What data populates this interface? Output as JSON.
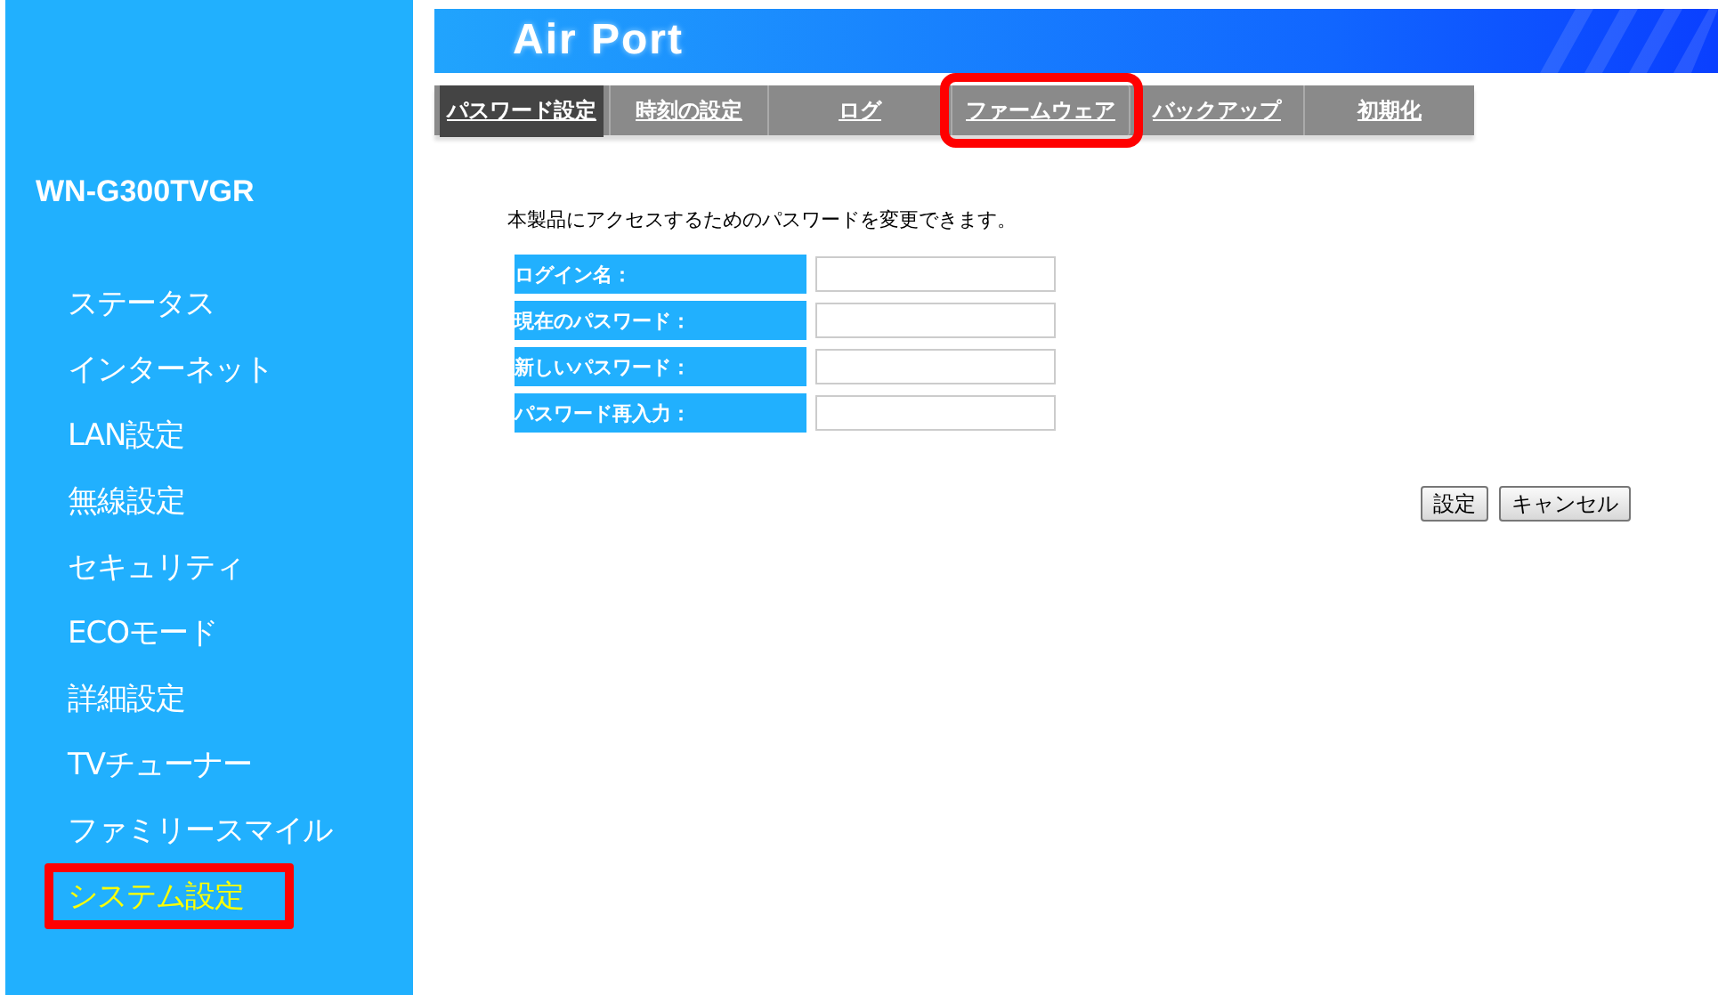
{
  "header": {
    "logo": "Air Port"
  },
  "sidebar": {
    "model": "WN-G300TVGR",
    "items": [
      {
        "label": "ステータス",
        "selected": false,
        "highlighted": false
      },
      {
        "label": "インターネット",
        "selected": false,
        "highlighted": false
      },
      {
        "label": "LAN設定",
        "selected": false,
        "highlighted": false
      },
      {
        "label": "無線設定",
        "selected": false,
        "highlighted": false
      },
      {
        "label": "セキュリティ",
        "selected": false,
        "highlighted": false
      },
      {
        "label": "ECOモード",
        "selected": false,
        "highlighted": false
      },
      {
        "label": "詳細設定",
        "selected": false,
        "highlighted": false
      },
      {
        "label": "TVチューナー",
        "selected": false,
        "highlighted": false
      },
      {
        "label": "ファミリースマイル",
        "selected": false,
        "highlighted": false
      },
      {
        "label": "システム設定",
        "selected": true,
        "highlighted": true
      }
    ]
  },
  "tabs": [
    {
      "label": "パスワード設定",
      "selected": true,
      "highlighted": false
    },
    {
      "label": "時刻の設定",
      "selected": false,
      "highlighted": false
    },
    {
      "label": "ログ",
      "selected": false,
      "highlighted": false
    },
    {
      "label": "ファームウェア",
      "selected": false,
      "highlighted": true
    },
    {
      "label": "バックアップ",
      "selected": false,
      "highlighted": false
    },
    {
      "label": "初期化",
      "selected": false,
      "highlighted": false
    }
  ],
  "description": "本製品にアクセスするためのパスワードを変更できます。",
  "form": {
    "fields": [
      {
        "label": "ログイン名："
      },
      {
        "label": "現在のパスワード："
      },
      {
        "label": "新しいパスワード："
      },
      {
        "label": "パスワード再入力："
      }
    ]
  },
  "buttons": [
    "設定",
    "キャンセル"
  ]
}
